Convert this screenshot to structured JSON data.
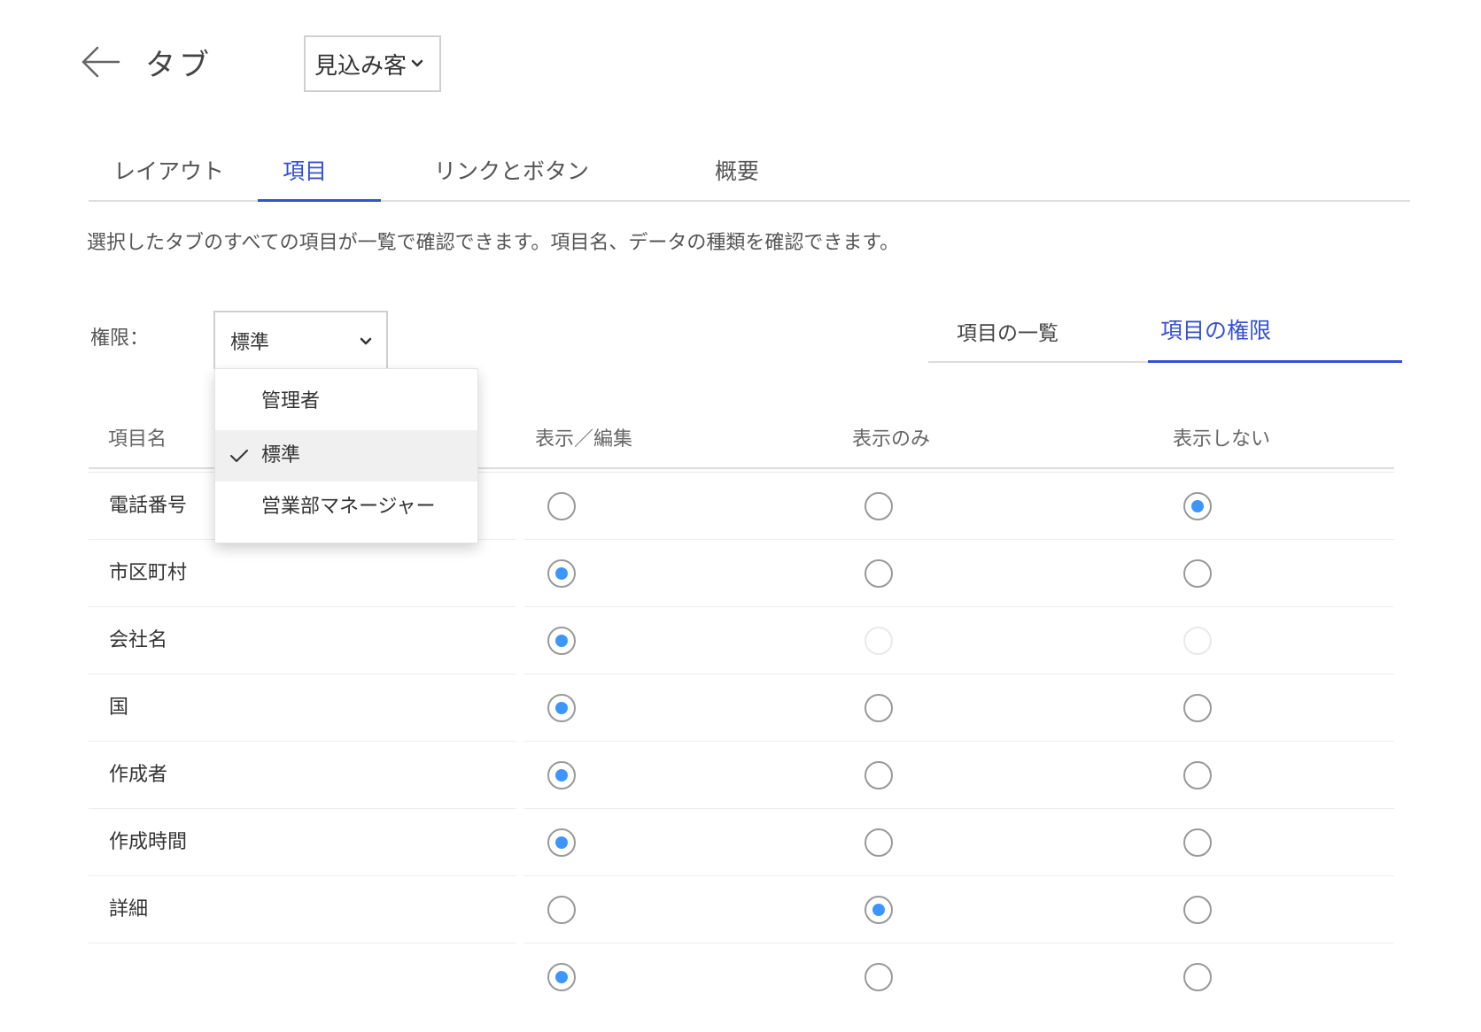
{
  "header": {
    "title": "タブ",
    "object_select": "見込み客"
  },
  "tabs": [
    {
      "label": "レイアウト"
    },
    {
      "label": "項目"
    },
    {
      "label": "リンクとボタン"
    },
    {
      "label": "概要"
    }
  ],
  "active_tab": "項目",
  "description": "選択したタブのすべての項目が一覧で確認できます。項目名、データの種類を確認できます。",
  "permission": {
    "label": "権限：",
    "selected": "標準",
    "options": [
      "管理者",
      "標準",
      "営業部マネージャー"
    ]
  },
  "subtabs": [
    {
      "label": "項目の一覧"
    },
    {
      "label": "項目の権限"
    }
  ],
  "active_subtab": "項目の権限",
  "table": {
    "headers": [
      "項目名",
      "表示／編集",
      "表示のみ",
      "表示しない"
    ],
    "rows": [
      {
        "name": "電話番号",
        "selected": "表示しない"
      },
      {
        "name": "市区町村",
        "selected": "表示／編集"
      },
      {
        "name": "会社名",
        "selected": "表示／編集",
        "disabled": [
          "表示のみ",
          "表示しない"
        ]
      },
      {
        "name": "国",
        "selected": "表示／編集"
      },
      {
        "name": "作成者",
        "selected": "表示／編集"
      },
      {
        "name": "作成時間",
        "selected": "表示／編集"
      },
      {
        "name": "詳細",
        "selected": "表示のみ"
      },
      {
        "name": "",
        "selected": "表示／編集"
      }
    ]
  },
  "colors": {
    "accent": "#3550d0",
    "radio_fill": "#3d96ff",
    "border": "#cfcfcf"
  },
  "icons": [
    "back-arrow-icon",
    "chevron-down-icon",
    "check-icon"
  ]
}
